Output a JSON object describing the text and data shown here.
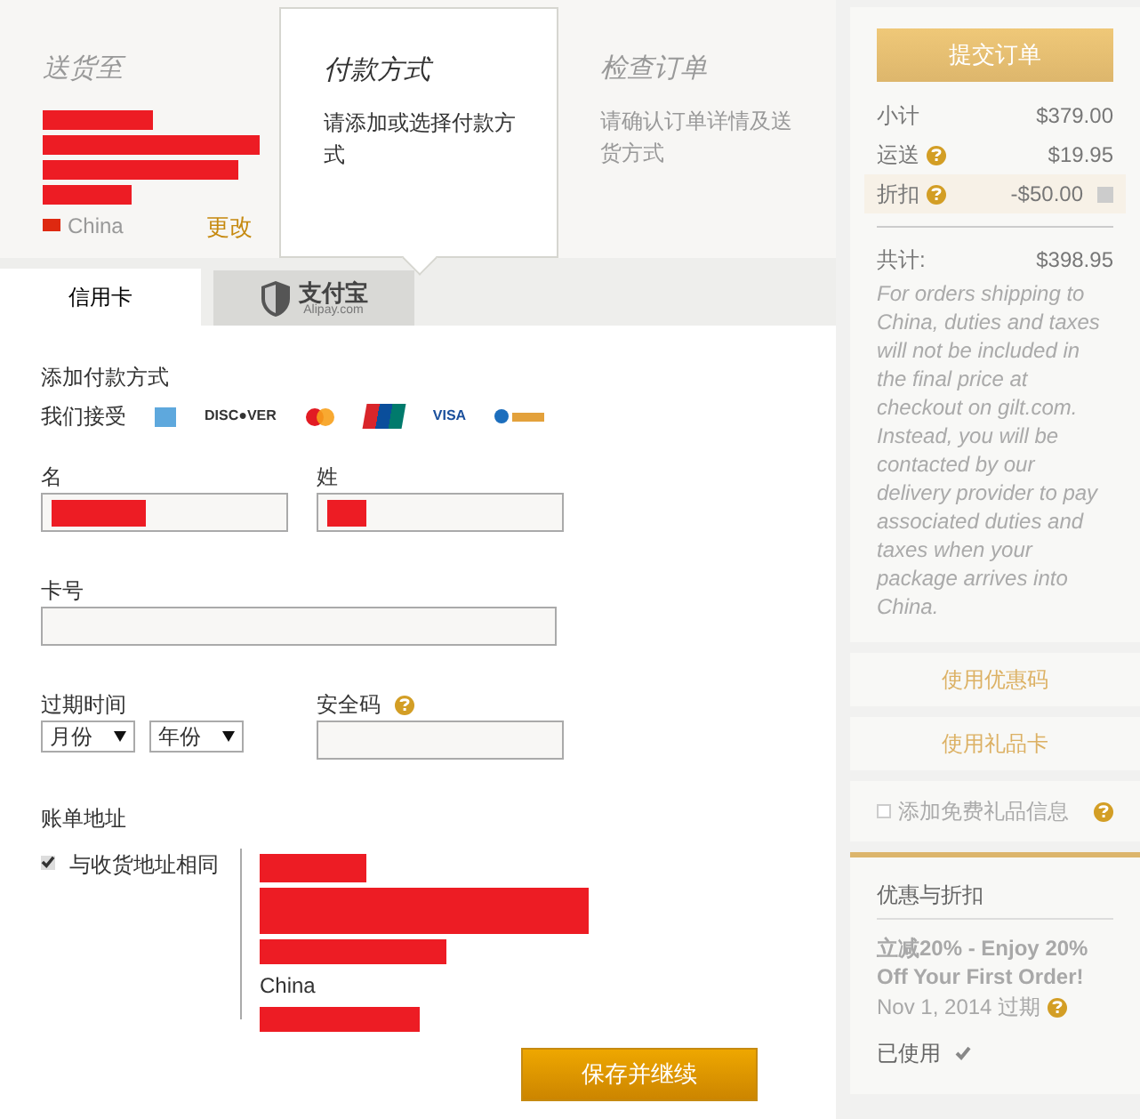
{
  "steps": [
    {
      "title": "送货至",
      "selected": false,
      "address": [
        {
          "kind": "redacted"
        },
        {
          "kind": "redacted"
        },
        {
          "kind": "redacted"
        },
        {
          "kind": "redacted"
        },
        {
          "kind": "country",
          "text": "China"
        }
      ],
      "action": "更改"
    },
    {
      "title": "付款方式",
      "selected": true,
      "description": "请添加或选择付款方式"
    },
    {
      "title": "检查订单",
      "selected": false,
      "description": "请确认订单详情及送货方式"
    }
  ],
  "payment_tabs": [
    {
      "kind": "text",
      "label": "信用卡",
      "selected": true
    },
    {
      "kind": "logo",
      "label": "支付宝",
      "sublabel": "Alipay.com",
      "selected": false
    }
  ],
  "form": {
    "title": "添加付款方式",
    "accept_label": "我们接受",
    "card_brands": [
      {
        "kind": "amex"
      },
      {
        "kind": "discover",
        "text": "DISC●VER"
      },
      {
        "kind": "mastercard"
      },
      {
        "kind": "unionpay"
      },
      {
        "kind": "visa",
        "text": "VISA"
      },
      {
        "kind": "alipay"
      }
    ],
    "first_name": {
      "label": "名",
      "redacted": true
    },
    "last_name": {
      "label": "姓",
      "redacted": true
    },
    "card_number": {
      "label": "卡号"
    },
    "expiry": {
      "label": "过期时间",
      "month": "月份",
      "year": "年份"
    },
    "security_code": {
      "label": "安全码",
      "help": true
    },
    "billing": {
      "title": "账单地址",
      "same_as_shipping": {
        "label": "与收货地址相同",
        "checked": true
      },
      "address": [
        {
          "kind": "redacted"
        },
        {
          "kind": "redacted"
        },
        {
          "kind": "redacted"
        },
        {
          "kind": "country",
          "text": "China"
        },
        {
          "kind": "redacted"
        }
      ]
    },
    "submit": "保存并继续"
  },
  "sidebar": {
    "submit": "提交订单",
    "summary": [
      {
        "label": "小计",
        "value": "$379.00"
      },
      {
        "label": "运送",
        "value": "$19.95",
        "help": true
      },
      {
        "label": "折扣",
        "value": "-$50.00",
        "help": true,
        "highlighted": true,
        "removable": true
      }
    ],
    "total": {
      "label": "共计:",
      "value": "$398.95"
    },
    "note": "For orders shipping to China, duties and taxes will not be included in the final price at checkout on gilt.com. Instead, you will be contacted by our delivery provider to pay associated duties and taxes when your package arrives into China.",
    "links": [
      "使用优惠码",
      "使用礼品卡"
    ],
    "gift_message": {
      "label": "添加免费礼品信息",
      "checked": false,
      "help": true
    },
    "promotions": {
      "title": "优惠与折扣",
      "items": [
        {
          "name": "立减20% - Enjoy 20% Off Your First Order!",
          "expiry": "Nov 1, 2014 过期",
          "help": true,
          "status": "已使用",
          "used": true
        }
      ]
    }
  }
}
